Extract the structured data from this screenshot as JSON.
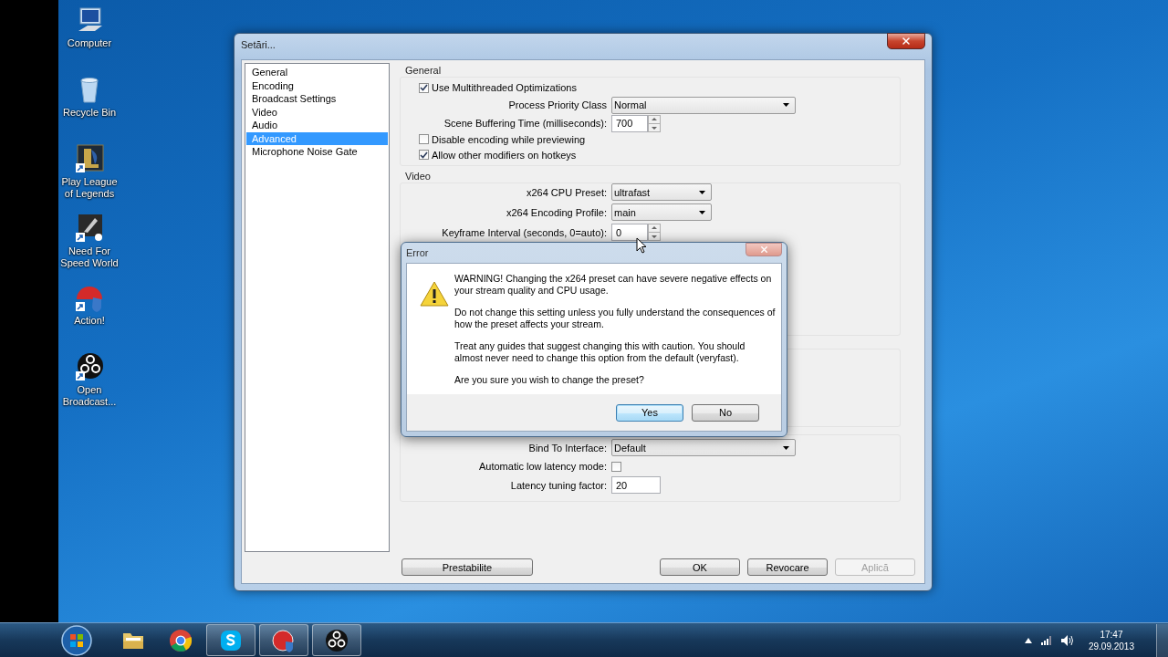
{
  "desktop_icons": [
    {
      "label": "Computer",
      "kind": "computer"
    },
    {
      "label": "Recycle Bin",
      "kind": "recycle"
    },
    {
      "label": "Play League of Legends",
      "kind": "game"
    },
    {
      "label": "Need For Speed World",
      "kind": "car"
    },
    {
      "label": "Action!",
      "kind": "action"
    },
    {
      "label": "Open Broadcast...",
      "kind": "obs"
    }
  ],
  "window": {
    "title": "Setări..."
  },
  "sidebar": {
    "items": [
      {
        "label": "General",
        "selected": false
      },
      {
        "label": "Encoding",
        "selected": false
      },
      {
        "label": "Broadcast Settings",
        "selected": false
      },
      {
        "label": "Video",
        "selected": false
      },
      {
        "label": "Audio",
        "selected": false
      },
      {
        "label": "Advanced",
        "selected": true
      },
      {
        "label": "Microphone Noise Gate",
        "selected": false
      }
    ]
  },
  "sections": [
    {
      "kind": "group",
      "title": "General",
      "rows": [
        {
          "kind": "checkbox",
          "label": "Use Multithreaded Optimizations",
          "checked": true
        },
        {
          "kind": "select",
          "label": "Process Priority Class",
          "value": "Normal"
        },
        {
          "kind": "spin",
          "label": "Scene Buffering Time (milliseconds):",
          "value": "700"
        },
        {
          "kind": "checkbox",
          "label": "Disable encoding while previewing",
          "checked": false
        },
        {
          "kind": "checkbox",
          "label": "Allow other modifiers on hotkeys",
          "checked": true
        }
      ]
    },
    {
      "kind": "group",
      "title": "Video",
      "rows": [
        {
          "kind": "select_short",
          "label": "x264 CPU Preset:",
          "value": "ultrafast"
        },
        {
          "kind": "select_short",
          "label": "x264 Encoding Profile:",
          "value": "main"
        },
        {
          "kind": "spin",
          "label": "Keyframe Interval (seconds, 0=auto):",
          "value": "0"
        }
      ]
    },
    {
      "kind": "blank"
    },
    {
      "kind": "group",
      "rows": [
        {
          "kind": "select",
          "label": "Bind To Interface:",
          "value": "Default"
        },
        {
          "kind": "checkbox_right",
          "label": "Automatic low latency mode:",
          "checked": false
        },
        {
          "kind": "text",
          "label": "Latency tuning factor:",
          "value": "20"
        }
      ]
    }
  ],
  "buttons": [
    {
      "label": "Prestabilite",
      "disabled": false
    },
    {
      "label": "OK",
      "disabled": false
    },
    {
      "label": "Revocare",
      "disabled": false
    },
    {
      "label": "Aplică",
      "disabled": true
    }
  ],
  "dialog": {
    "title": "Error",
    "paragraphs": [
      "WARNING! Changing the x264 preset can have severe negative effects on your stream quality and CPU usage.",
      "Do not change this setting unless you fully understand the consequences of how the preset affects your stream.",
      "Treat any guides that suggest changing this with caution. You should almost never need to change this option from the default (veryfast).",
      "Are you sure you wish to change the preset?"
    ],
    "buttons": [
      {
        "label": "Yes",
        "selected": true
      },
      {
        "label": "No",
        "selected": false
      }
    ]
  },
  "taskbar": {
    "apps": [
      {
        "kind": "folder",
        "running": false
      },
      {
        "kind": "chrome",
        "running": false
      },
      {
        "kind": "skype",
        "running": true
      },
      {
        "kind": "action",
        "running": true
      },
      {
        "kind": "obs",
        "running": true
      }
    ],
    "time": "17:47",
    "date": "29.09.2013"
  }
}
